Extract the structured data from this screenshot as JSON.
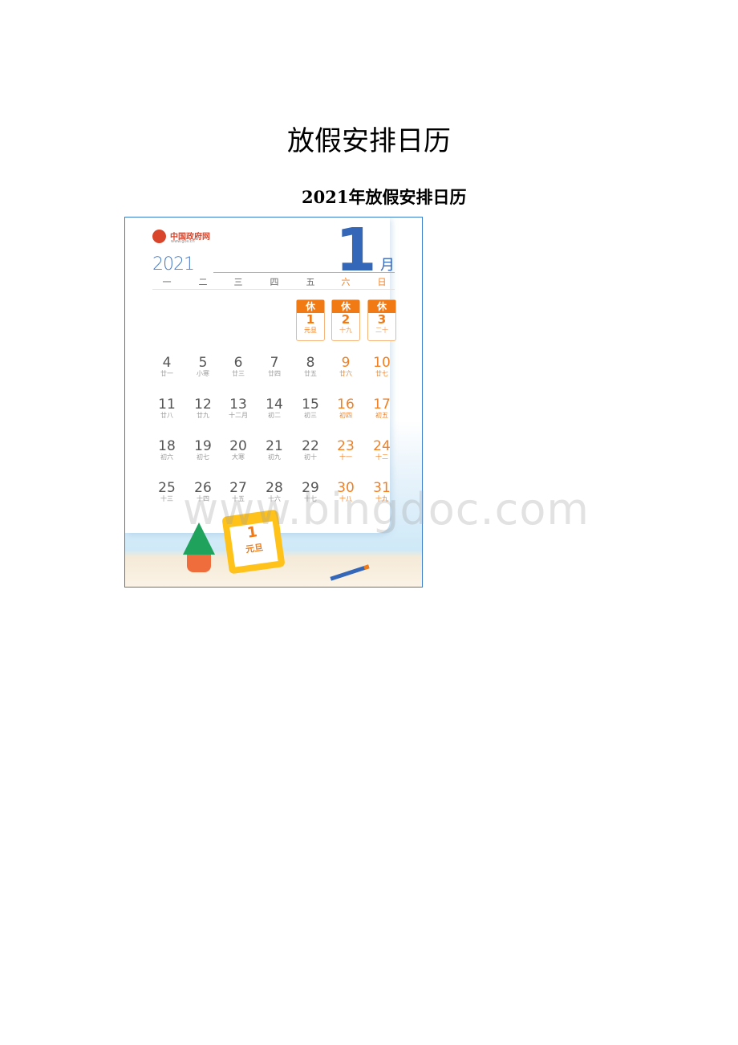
{
  "page": {
    "title": "放假安排日历",
    "subtitle": "2021年放假安排日历"
  },
  "calendar": {
    "brand": "中国政府网",
    "brand_url": "www.gov.cn",
    "year": "2021",
    "month_number": "1",
    "month_unit": "月",
    "weekdays": [
      "一",
      "二",
      "三",
      "四",
      "五",
      "六",
      "日"
    ],
    "holiday_tag": "休",
    "holidays": [
      {
        "day": "1",
        "lunar": "元旦"
      },
      {
        "day": "2",
        "lunar": "十九"
      },
      {
        "day": "3",
        "lunar": "二十"
      }
    ],
    "weeks": [
      [
        {
          "day": "4",
          "lunar": "廿一"
        },
        {
          "day": "5",
          "lunar": "小寒"
        },
        {
          "day": "6",
          "lunar": "廿三"
        },
        {
          "day": "7",
          "lunar": "廿四"
        },
        {
          "day": "8",
          "lunar": "廿五"
        },
        {
          "day": "9",
          "lunar": "廿六"
        },
        {
          "day": "10",
          "lunar": "廿七"
        }
      ],
      [
        {
          "day": "11",
          "lunar": "廿八"
        },
        {
          "day": "12",
          "lunar": "廿九"
        },
        {
          "day": "13",
          "lunar": "十二月"
        },
        {
          "day": "14",
          "lunar": "初二"
        },
        {
          "day": "15",
          "lunar": "初三"
        },
        {
          "day": "16",
          "lunar": "初四"
        },
        {
          "day": "17",
          "lunar": "初五"
        }
      ],
      [
        {
          "day": "18",
          "lunar": "初六"
        },
        {
          "day": "19",
          "lunar": "初七"
        },
        {
          "day": "20",
          "lunar": "大寒"
        },
        {
          "day": "21",
          "lunar": "初九"
        },
        {
          "day": "22",
          "lunar": "初十"
        },
        {
          "day": "23",
          "lunar": "十一"
        },
        {
          "day": "24",
          "lunar": "十二"
        }
      ],
      [
        {
          "day": "25",
          "lunar": "十三"
        },
        {
          "day": "26",
          "lunar": "十四"
        },
        {
          "day": "27",
          "lunar": "十五"
        },
        {
          "day": "28",
          "lunar": "十六"
        },
        {
          "day": "29",
          "lunar": "十七"
        },
        {
          "day": "30",
          "lunar": "十八"
        },
        {
          "day": "31",
          "lunar": "十九"
        }
      ]
    ],
    "illustration": {
      "calendar_day": "1",
      "calendar_label": "元旦"
    },
    "colors": {
      "accent": "#f27a14",
      "blue": "#3567b8",
      "weekday_text": "#555555"
    }
  },
  "watermark": "www.bingdoc.com"
}
